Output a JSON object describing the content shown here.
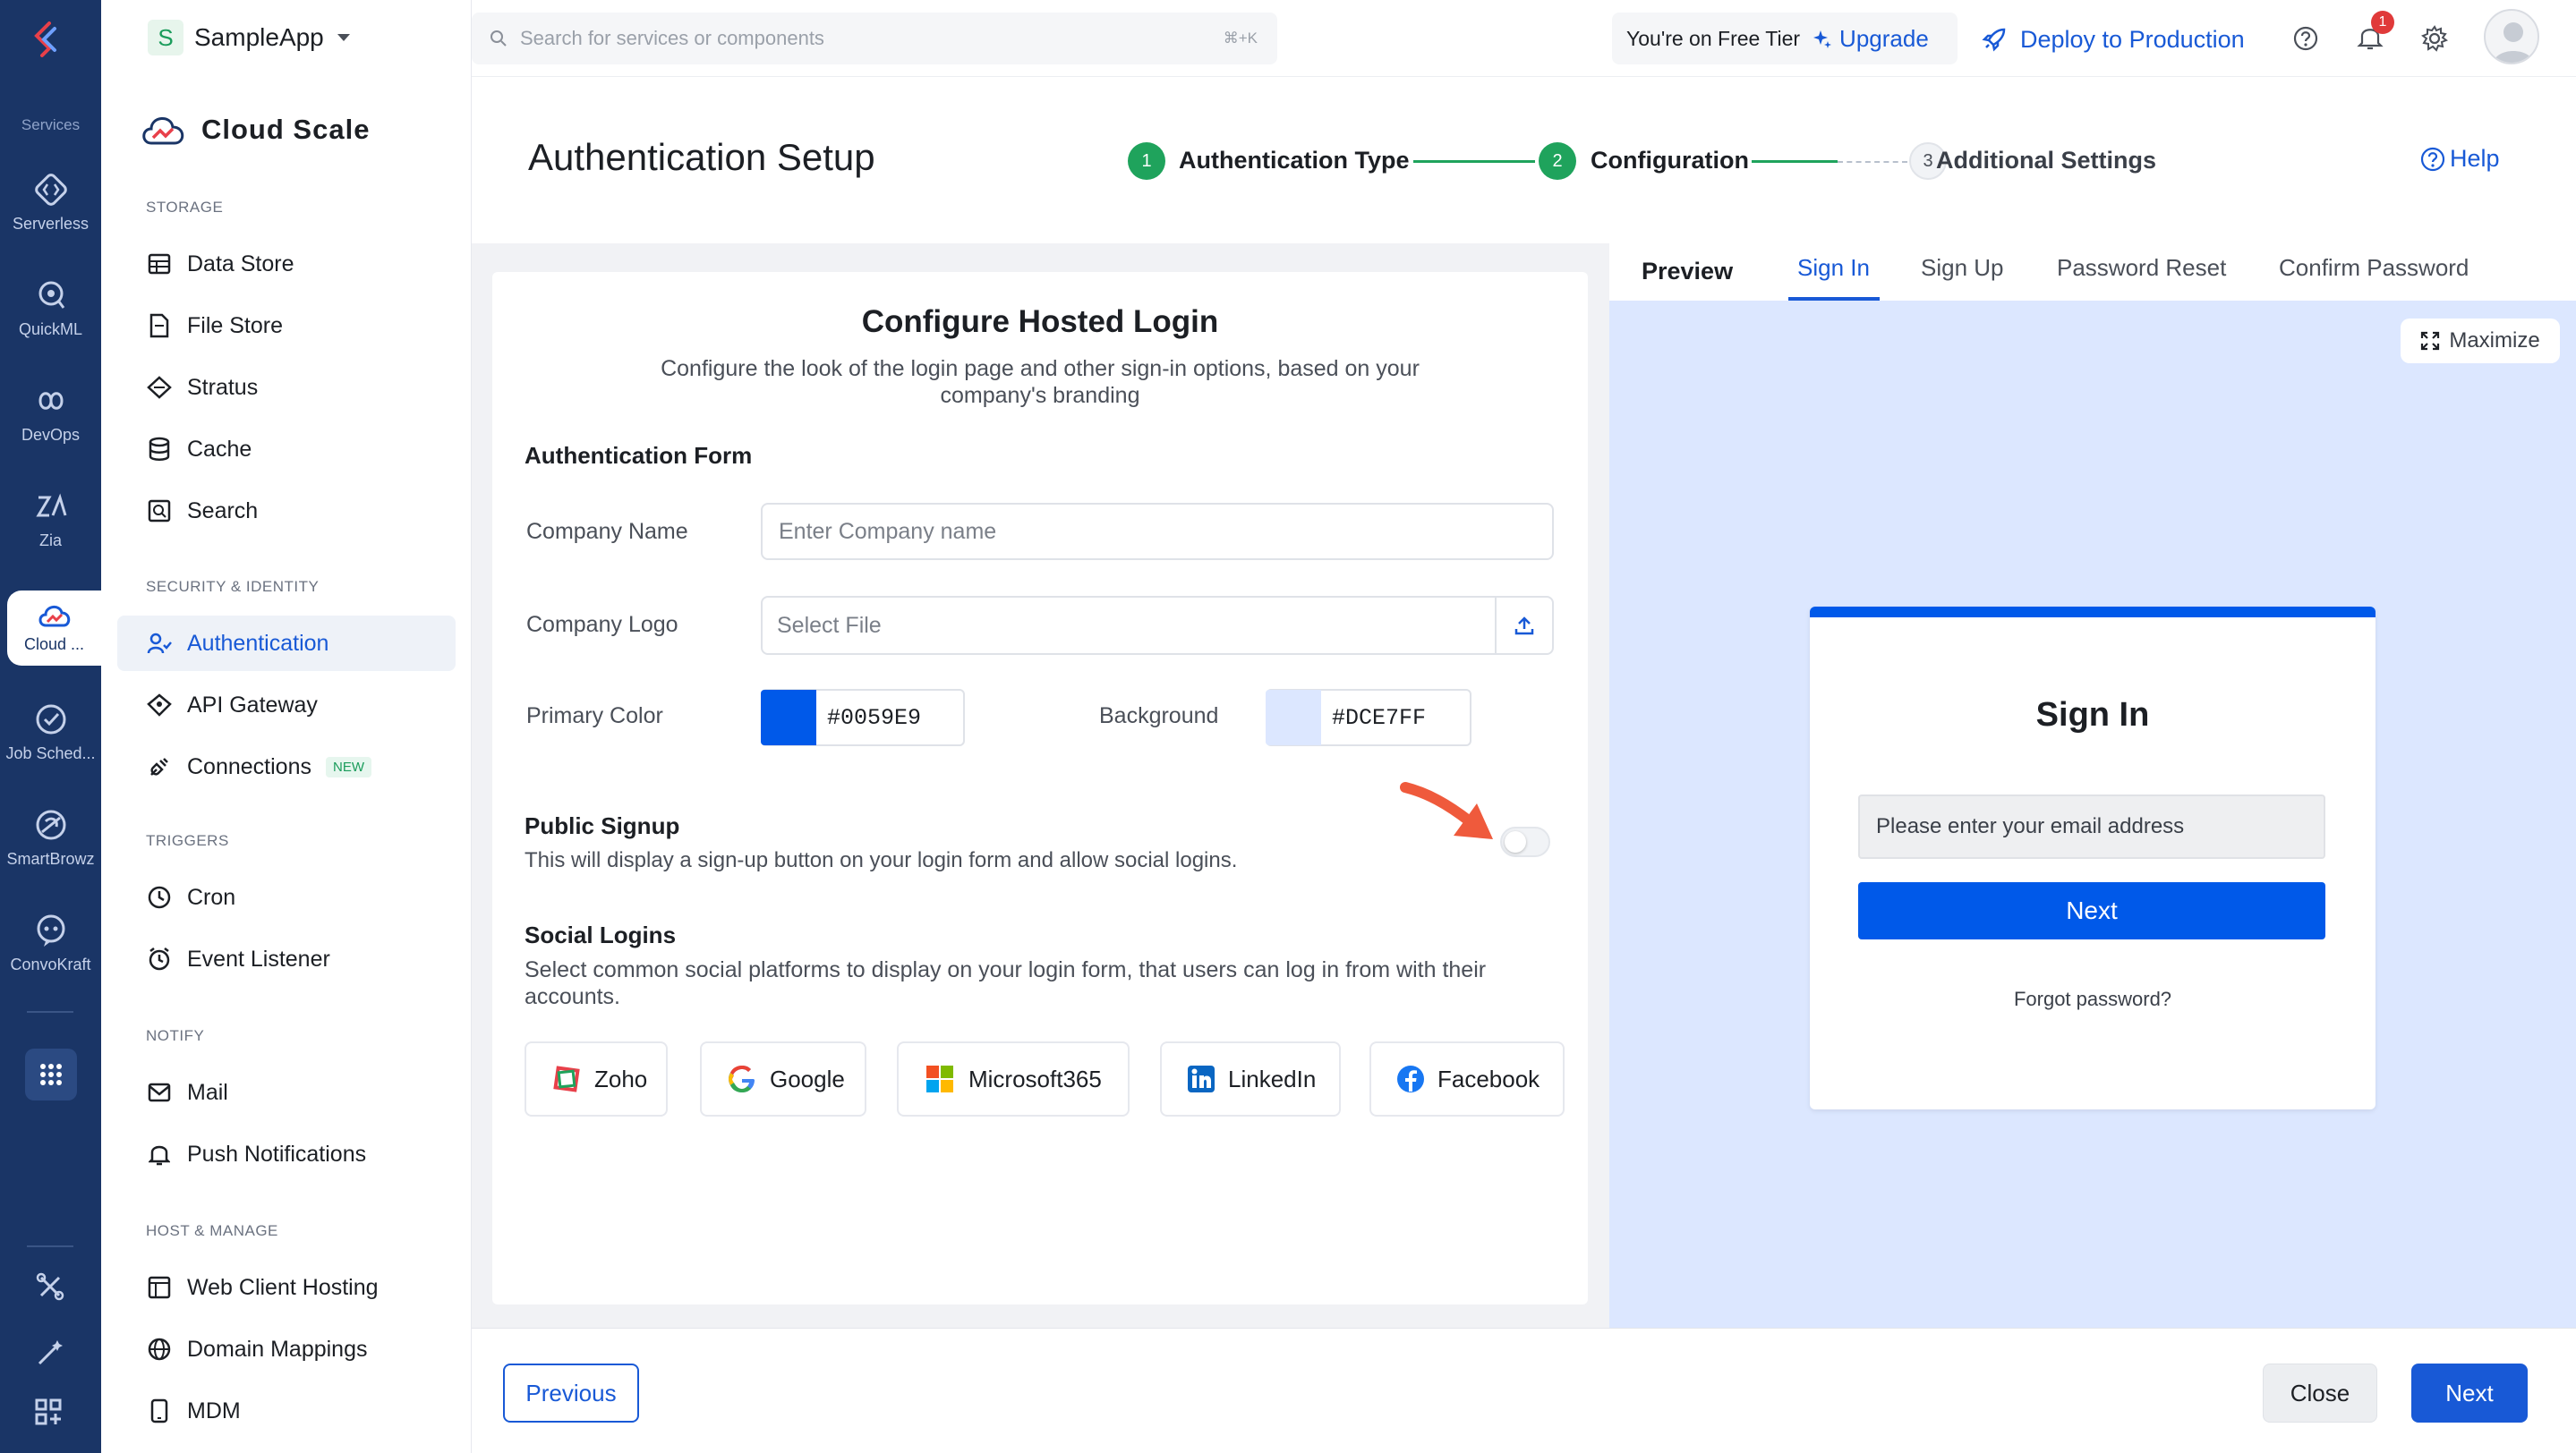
{
  "rail": {
    "services_label": "Services",
    "items": [
      {
        "label": "Serverless",
        "icon": "serverless-icon"
      },
      {
        "label": "QuickML",
        "icon": "quickml-icon"
      },
      {
        "label": "DevOps",
        "icon": "devops-icon"
      },
      {
        "label": "Zia",
        "icon": "zia-icon"
      },
      {
        "label": "Cloud ...",
        "icon": "cloud-scale-icon"
      },
      {
        "label": "Job Sched...",
        "icon": "job-scheduling-icon"
      },
      {
        "label": "SmartBrowz",
        "icon": "smartbrowz-icon"
      },
      {
        "label": "ConvoKraft",
        "icon": "convokraft-icon"
      }
    ],
    "accent": "#1a3566"
  },
  "app": {
    "initial": "S",
    "name": "SampleApp"
  },
  "search": {
    "placeholder": "Search for services or components",
    "shortcut": "⌘+K"
  },
  "topbar": {
    "tier_text": "You're on Free Tier",
    "upgrade_label": "Upgrade",
    "deploy_label": "Deploy to Production",
    "notification_count": "1"
  },
  "sidebar": {
    "title": "Cloud Scale",
    "sections": {
      "storage": "STORAGE",
      "security": "SECURITY & IDENTITY",
      "triggers": "TRIGGERS",
      "notify": "NOTIFY",
      "host": "HOST & MANAGE"
    },
    "items": {
      "data_store": "Data Store",
      "file_store": "File Store",
      "stratus": "Stratus",
      "cache": "Cache",
      "search": "Search",
      "authentication": "Authentication",
      "api_gateway": "API Gateway",
      "connections": "Connections",
      "connections_badge": "NEW",
      "cron": "Cron",
      "event_listener": "Event Listener",
      "mail": "Mail",
      "push_notifications": "Push Notifications",
      "web_client_hosting": "Web Client Hosting",
      "domain_mappings": "Domain Mappings",
      "mdm": "MDM"
    }
  },
  "header": {
    "title": "Authentication Setup",
    "help_label": "Help",
    "steps": [
      {
        "number": "1",
        "label": "Authentication Type",
        "state": "done"
      },
      {
        "number": "2",
        "label": "Configuration",
        "state": "active"
      },
      {
        "number": "3",
        "label": "Additional Settings",
        "state": "pending"
      }
    ]
  },
  "form": {
    "title": "Configure Hosted Login",
    "subtitle_line1": "Configure the look of the login page and other sign-in options, based on your",
    "subtitle_line2": "company's branding",
    "auth_form_heading": "Authentication Form",
    "company_name_label": "Company Name",
    "company_name_placeholder": "Enter Company name",
    "company_logo_label": "Company Logo",
    "company_logo_placeholder": "Select File",
    "primary_color_label": "Primary Color",
    "primary_color_value": "#0059E9",
    "background_label": "Background",
    "background_value": "#DCE7FF",
    "public_signup_heading": "Public Signup",
    "public_signup_desc": "This will display a sign-up button on your login form and allow social logins.",
    "public_signup_enabled": false,
    "social_heading": "Social Logins",
    "social_desc_line1": "Select common social platforms to display on your login form, that users can log in from with their",
    "social_desc_line2": "accounts.",
    "socials": [
      "Zoho",
      "Google",
      "Microsoft365",
      "LinkedIn",
      "Facebook"
    ]
  },
  "preview": {
    "heading": "Preview",
    "tabs": [
      "Sign In",
      "Sign Up",
      "Password Reset",
      "Confirm Password"
    ],
    "active_tab": "Sign In",
    "maximize_label": "Maximize",
    "card_title": "Sign In",
    "email_placeholder": "Please enter your email address",
    "next_label": "Next",
    "forgot_label": "Forgot password?"
  },
  "footer": {
    "previous_label": "Previous",
    "close_label": "Close",
    "next_label": "Next"
  },
  "colors": {
    "primary": "#0059E9",
    "background": "#DCE7FF",
    "accent_blue": "#1859d6",
    "step_green": "#1fa35c"
  }
}
